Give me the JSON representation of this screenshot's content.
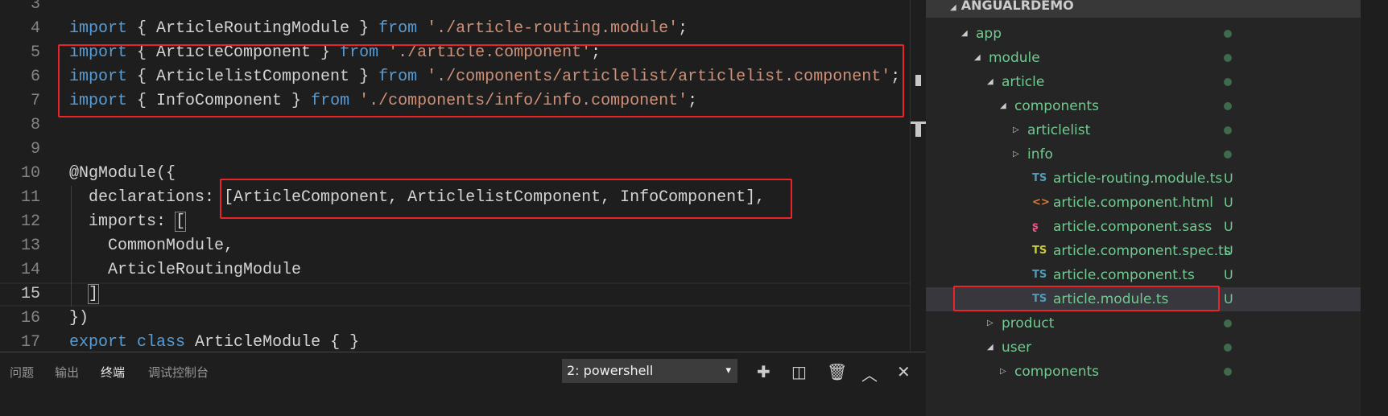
{
  "editor": {
    "current_line": 15,
    "lines": [
      {
        "n": "3",
        "tokens": []
      },
      {
        "n": "4",
        "tokens": [
          [
            "kw",
            "import"
          ],
          [
            "plain",
            " { ArticleRoutingModule } "
          ],
          [
            "kw",
            "from"
          ],
          [
            "plain",
            " "
          ],
          [
            "str",
            "'./article-routing.module'"
          ],
          [
            "plain",
            ";"
          ]
        ]
      },
      {
        "n": "5",
        "tokens": [
          [
            "kw",
            "import"
          ],
          [
            "plain",
            " { ArticleComponent } "
          ],
          [
            "kw",
            "from"
          ],
          [
            "plain",
            " "
          ],
          [
            "str",
            "'./article.component'"
          ],
          [
            "plain",
            ";"
          ]
        ]
      },
      {
        "n": "6",
        "tokens": [
          [
            "kw",
            "import"
          ],
          [
            "plain",
            " { ArticlelistComponent } "
          ],
          [
            "kw",
            "from"
          ],
          [
            "plain",
            " "
          ],
          [
            "str",
            "'./components/articlelist/articlelist.component'"
          ],
          [
            "plain",
            ";"
          ]
        ]
      },
      {
        "n": "7",
        "tokens": [
          [
            "kw",
            "import"
          ],
          [
            "plain",
            " { InfoComponent } "
          ],
          [
            "kw",
            "from"
          ],
          [
            "plain",
            " "
          ],
          [
            "str",
            "'./components/info/info.component'"
          ],
          [
            "plain",
            ";"
          ]
        ]
      },
      {
        "n": "8",
        "tokens": []
      },
      {
        "n": "9",
        "tokens": []
      },
      {
        "n": "10",
        "tokens": [
          [
            "plain",
            "@NgModule({"
          ]
        ]
      },
      {
        "n": "11",
        "tokens": [
          [
            "plain",
            "  declarations: [ArticleComponent, ArticlelistComponent, InfoComponent],"
          ]
        ]
      },
      {
        "n": "12",
        "tokens": [
          [
            "plain",
            "  imports: "
          ],
          [
            "bracket",
            "["
          ]
        ]
      },
      {
        "n": "13",
        "tokens": [
          [
            "plain",
            "    CommonModule,"
          ]
        ]
      },
      {
        "n": "14",
        "tokens": [
          [
            "plain",
            "    ArticleRoutingModule"
          ]
        ]
      },
      {
        "n": "15",
        "tokens": [
          [
            "plain",
            "  "
          ],
          [
            "bracket",
            "]"
          ]
        ]
      },
      {
        "n": "16",
        "tokens": [
          [
            "plain",
            "})"
          ]
        ]
      },
      {
        "n": "17",
        "tokens": [
          [
            "kw",
            "export"
          ],
          [
            "plain",
            " "
          ],
          [
            "kw",
            "class"
          ],
          [
            "plain",
            " ArticleModule { }"
          ]
        ]
      }
    ]
  },
  "explorer": {
    "title": "ANGUALRDEMO",
    "items": [
      {
        "label": "app",
        "depth": 0,
        "twistie": "open",
        "status": "dot"
      },
      {
        "label": "module",
        "depth": 1,
        "twistie": "open",
        "status": "dot"
      },
      {
        "label": "article",
        "depth": 2,
        "twistie": "open",
        "status": "dot"
      },
      {
        "label": "components",
        "depth": 3,
        "twistie": "open",
        "status": "dot"
      },
      {
        "label": "articlelist",
        "depth": 4,
        "twistie": "closed",
        "status": "dot"
      },
      {
        "label": "info",
        "depth": 4,
        "twistie": "closed",
        "status": "dot"
      },
      {
        "label": "article-routing.module.ts",
        "depth": 3,
        "icon": "TS",
        "icon_color": "#519aba",
        "status": "U"
      },
      {
        "label": "article.component.html",
        "depth": 3,
        "icon": "<>",
        "icon_color": "#e37933",
        "status": "U"
      },
      {
        "label": "article.component.sass",
        "depth": 3,
        "icon": "ʂ",
        "icon_color": "#f55385",
        "status": "U"
      },
      {
        "label": "article.component.spec.ts",
        "depth": 3,
        "icon": "TS",
        "icon_color": "#cbcb41",
        "status": "U"
      },
      {
        "label": "article.component.ts",
        "depth": 3,
        "icon": "TS",
        "icon_color": "#519aba",
        "status": "U"
      },
      {
        "label": "article.module.ts",
        "depth": 3,
        "icon": "TS",
        "icon_color": "#519aba",
        "status": "U",
        "selected": true
      },
      {
        "label": "product",
        "depth": 2,
        "twistie": "closed",
        "status": "dot"
      },
      {
        "label": "user",
        "depth": 2,
        "twistie": "open",
        "status": "dot"
      },
      {
        "label": "components",
        "depth": 3,
        "twistie": "closed",
        "status": "dot"
      }
    ]
  },
  "panel": {
    "tabs": [
      "问题",
      "输出",
      "终端",
      "调试控制台"
    ],
    "active_tab": "终端",
    "terminal_select": "2: powershell",
    "dropdown_arrow": "▾",
    "icons": [
      "plus-icon",
      "split-icon",
      "trash-icon",
      "chevron-up-icon",
      "close-icon"
    ]
  },
  "colors": {
    "highlight": "#e8262a",
    "keyword": "#569cd6",
    "string": "#ce9178",
    "git_untracked": "#73c991"
  }
}
